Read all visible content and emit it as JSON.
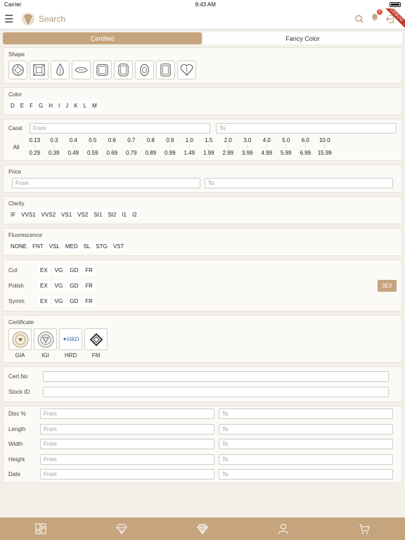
{
  "status_bar": {
    "carrier": "Carrier",
    "time": "9:43 AM"
  },
  "navbar": {
    "search_placeholder": "Search",
    "cart_count": "0",
    "ribbon": "DEBUG"
  },
  "tabs": [
    {
      "label": "Certified"
    },
    {
      "label": "Fancy Color"
    }
  ],
  "shape": {
    "label": "Shape",
    "items": [
      "round-icon",
      "princess-icon",
      "pear-icon",
      "marquise-icon",
      "cushion-icon",
      "emerald-icon",
      "oval-icon",
      "radiant-icon",
      "heart-icon"
    ]
  },
  "color": {
    "label": "Color",
    "options": [
      "D",
      "E",
      "F",
      "G",
      "H",
      "I",
      "J",
      "K",
      "L",
      "M"
    ]
  },
  "carat": {
    "label": "Carat",
    "from_placeholder": "From",
    "to_placeholder": "To",
    "all_label": "All",
    "ranges": [
      {
        "from": "0.13",
        "to": "0.29"
      },
      {
        "from": "0.3",
        "to": "0.39"
      },
      {
        "from": "0.4",
        "to": "0.49"
      },
      {
        "from": "0.5",
        "to": "0.59"
      },
      {
        "from": "0.6",
        "to": "0.69"
      },
      {
        "from": "0.7",
        "to": "0.79"
      },
      {
        "from": "0.8",
        "to": "0.89"
      },
      {
        "from": "0.9",
        "to": "0.99"
      },
      {
        "from": "1.0",
        "to": "1.49"
      },
      {
        "from": "1.5",
        "to": "1.99"
      },
      {
        "from": "2.0",
        "to": "2.99"
      },
      {
        "from": "3.0",
        "to": "3.99"
      },
      {
        "from": "4.0",
        "to": "4.99"
      },
      {
        "from": "5.0",
        "to": "5.99"
      },
      {
        "from": "6.0",
        "to": "6.99"
      },
      {
        "from": "10.0",
        "to": "15.99"
      }
    ]
  },
  "price": {
    "label": "Price",
    "from_placeholder": "From",
    "to_placeholder": "To"
  },
  "clarity": {
    "label": "Clarity",
    "options": [
      "IF",
      "VVS1",
      "VVS2",
      "VS1",
      "VS2",
      "SI1",
      "SI2",
      "I1",
      "I2"
    ]
  },
  "fluorescence": {
    "label": "Fluorescence",
    "options": [
      "NONE",
      "FNT",
      "VSL",
      "MED",
      "SL",
      "STG",
      "VST"
    ]
  },
  "make": {
    "cut_label": "Cut",
    "polish_label": "Polish",
    "symm_label": "Symm.",
    "options": [
      "EX",
      "VG",
      "GD",
      "FR"
    ],
    "three_ex_label": "3EX"
  },
  "certificate": {
    "label": "Certificate",
    "items": [
      {
        "name": "GIA"
      },
      {
        "name": "IGI"
      },
      {
        "name": "HRD"
      },
      {
        "name": "FM"
      }
    ],
    "hrd_logo_text": "HRD"
  },
  "ids": {
    "cert_no_label": "Cert.No",
    "stock_id_label": "Stock ID"
  },
  "measures": {
    "from_placeholder": "From",
    "to_placeholder": "To",
    "rows": [
      {
        "label": "Disc %"
      },
      {
        "label": "Length"
      },
      {
        "label": "Width"
      },
      {
        "label": "Height"
      },
      {
        "label": "Date"
      }
    ]
  },
  "colors": {
    "accent": "#c5a47e",
    "background": "#f3f0ea"
  }
}
